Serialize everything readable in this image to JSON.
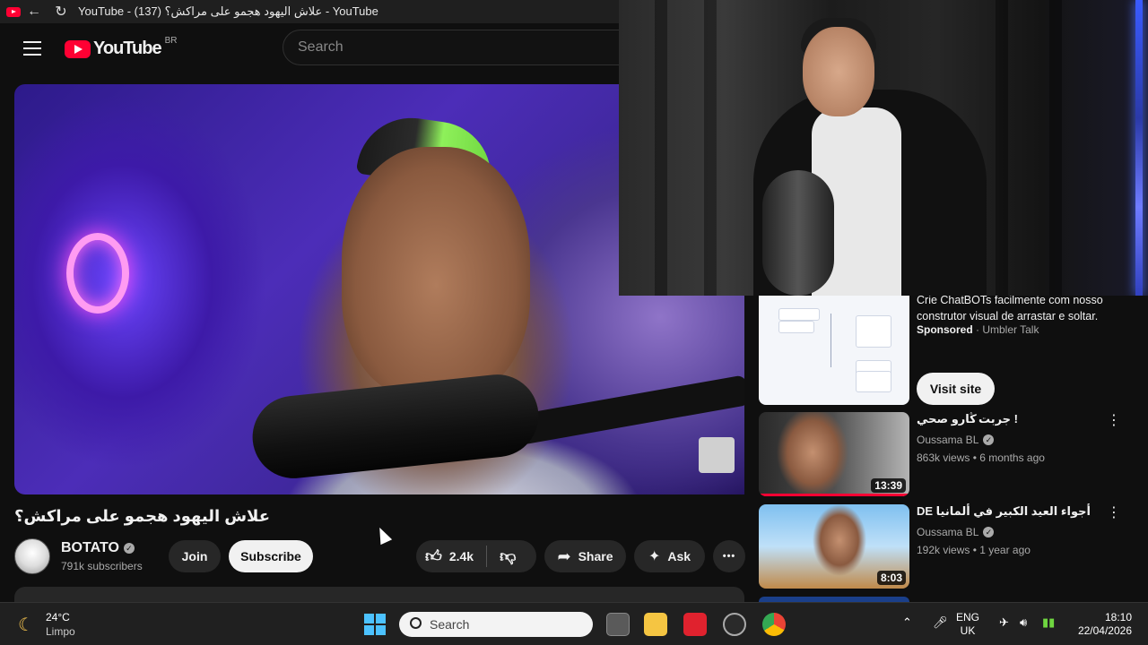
{
  "browser": {
    "tab_title": "YouTube - (137) علاش اليهود هجمو على مراكش؟ - YouTube"
  },
  "header": {
    "logo_text": "YouTube",
    "region": "BR",
    "search_placeholder": "Search"
  },
  "video": {
    "title": "علاش اليهود هجمو على مراكش؟",
    "channel_name": "BOTATO",
    "subscribers": "791k subscribers",
    "join_label": "Join",
    "subscribe_label": "Subscribe",
    "likes": "2.4k",
    "share_label": "Share",
    "ask_label": "Ask",
    "more_label": "•••"
  },
  "sidebar": {
    "ad": {
      "text": "Crie ChatBOTs facilmente com nosso construtor visual de arrastar e soltar.",
      "sponsored_label": "Sponsored",
      "advertiser": "· Umbler Talk",
      "cta": "Visit site"
    },
    "recommendations": [
      {
        "title": "! جربت ڭارو صحي",
        "channel": "Oussama BL",
        "meta": "863k views • 6 months ago",
        "duration": "13:39"
      },
      {
        "title": "DE أجواء العيد الكبير في ألمانيا",
        "channel": "Oussama BL",
        "meta": "192k views • 1 year ago",
        "duration": "8:03"
      }
    ]
  },
  "taskbar": {
    "temperature": "24°C",
    "condition": "Limpo",
    "search_label": "Search",
    "lang_line1": "ENG",
    "lang_line2": "UK",
    "time": "18:10",
    "date": "22/04/2026"
  },
  "colors": {
    "brand_red": "#ff0033",
    "background": "#0f0f0f",
    "pill": "#272727"
  }
}
